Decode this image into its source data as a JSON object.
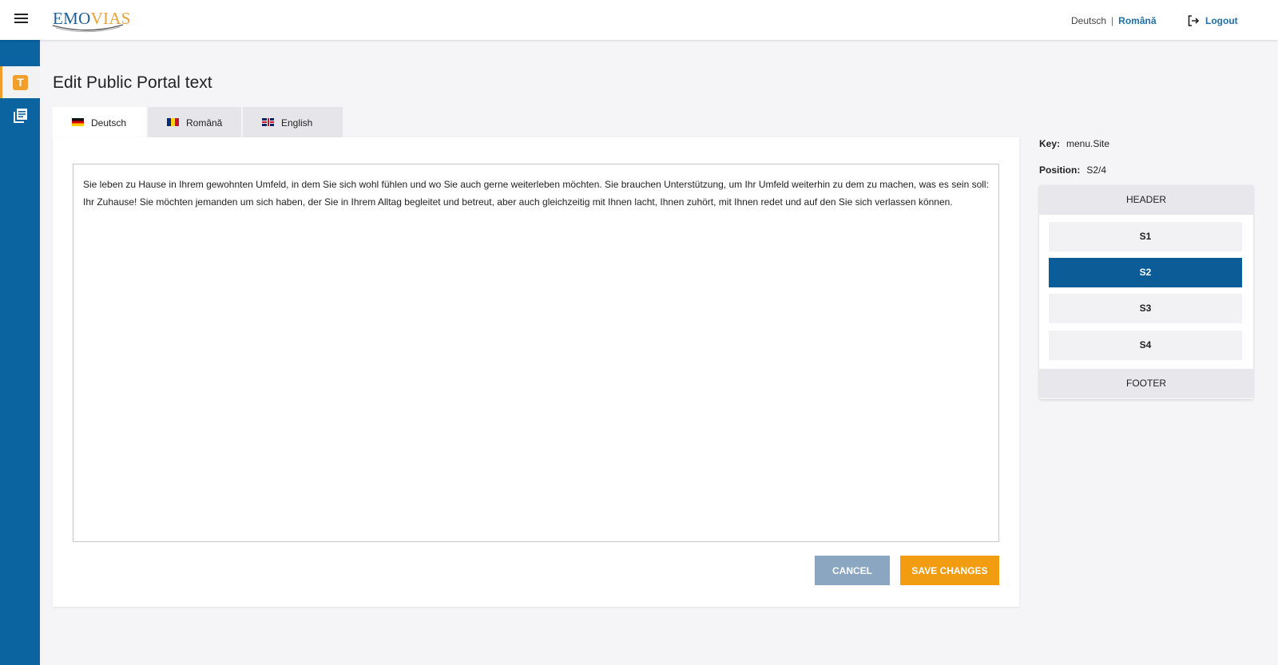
{
  "header": {
    "logo": {
      "part1": "EMO",
      "part2": "VIAS"
    },
    "languages": [
      {
        "label": "Deutsch",
        "active": false
      },
      {
        "label": "Română",
        "active": true
      }
    ],
    "logout_label": "Logout"
  },
  "sidebar": {
    "items": [
      {
        "icon": "text-t-icon",
        "active": true
      },
      {
        "icon": "document-list-icon",
        "active": false
      }
    ],
    "text_icon_glyph": "T"
  },
  "page": {
    "title": "Edit Public Portal text",
    "tabs": [
      {
        "label": "Deutsch",
        "flag": "german-flag-icon",
        "active": true
      },
      {
        "label": "Română",
        "flag": "romanian-flag-icon",
        "active": false
      },
      {
        "label": "English",
        "flag": "uk-flag-icon",
        "active": false
      }
    ],
    "editor_text": "Sie leben zu Hause in Ihrem gewohnten Umfeld, in dem Sie sich wohl fühlen und wo Sie auch gerne weiterleben möchten. Sie brauchen Unterstützung, um Ihr Umfeld weiterhin zu dem zu machen, was es sein soll: Ihr Zuhause! Sie möchten jemanden um sich haben, der Sie in Ihrem Alltag begleitet und betreut, aber auch gleichzeitig mit Ihnen lacht, Ihnen zuhört, mit Ihnen redet und auf den Sie sich verlassen können.",
    "cancel_label": "CANCEL",
    "save_label": "SAVE CHANGES"
  },
  "info": {
    "key_label": "Key:",
    "key_value": "menu.Site",
    "position_label": "Position:",
    "position_value": "S2/4"
  },
  "positions": {
    "header": "HEADER",
    "slots": [
      "S1",
      "S2",
      "S3",
      "S4"
    ],
    "selected": "S2",
    "footer": "FOOTER"
  },
  "colors": {
    "brand_blue": "#0b639f",
    "accent_orange": "#f29c12",
    "selected_blue": "#0b5c97",
    "cancel_gray_blue": "#8aa6c1"
  }
}
